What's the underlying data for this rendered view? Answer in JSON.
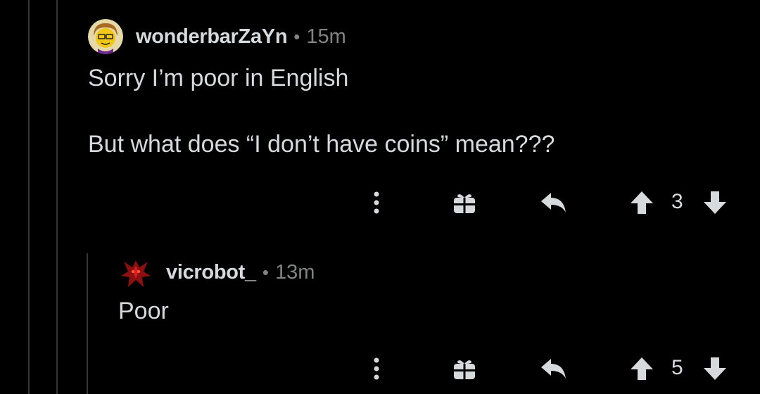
{
  "comments": [
    {
      "author": "wonderbarZaYn",
      "separator": "•",
      "time": "15m",
      "avatar_icon": "cartoon-avatar-icon",
      "body": [
        "Sorry I’m poor in English",
        "But what does “I don’t have coins” mean???"
      ],
      "votes": "3"
    },
    {
      "author": "vicrobot_",
      "separator": "•",
      "time": "13m",
      "avatar_icon": "red-creature-avatar-icon",
      "body": [
        "Poor"
      ],
      "votes": "5"
    }
  ],
  "colors": {
    "background": "#000000",
    "text": "#d7dadc",
    "muted": "#818384",
    "icon": "#d7dadc",
    "thread_line": "#343536"
  }
}
